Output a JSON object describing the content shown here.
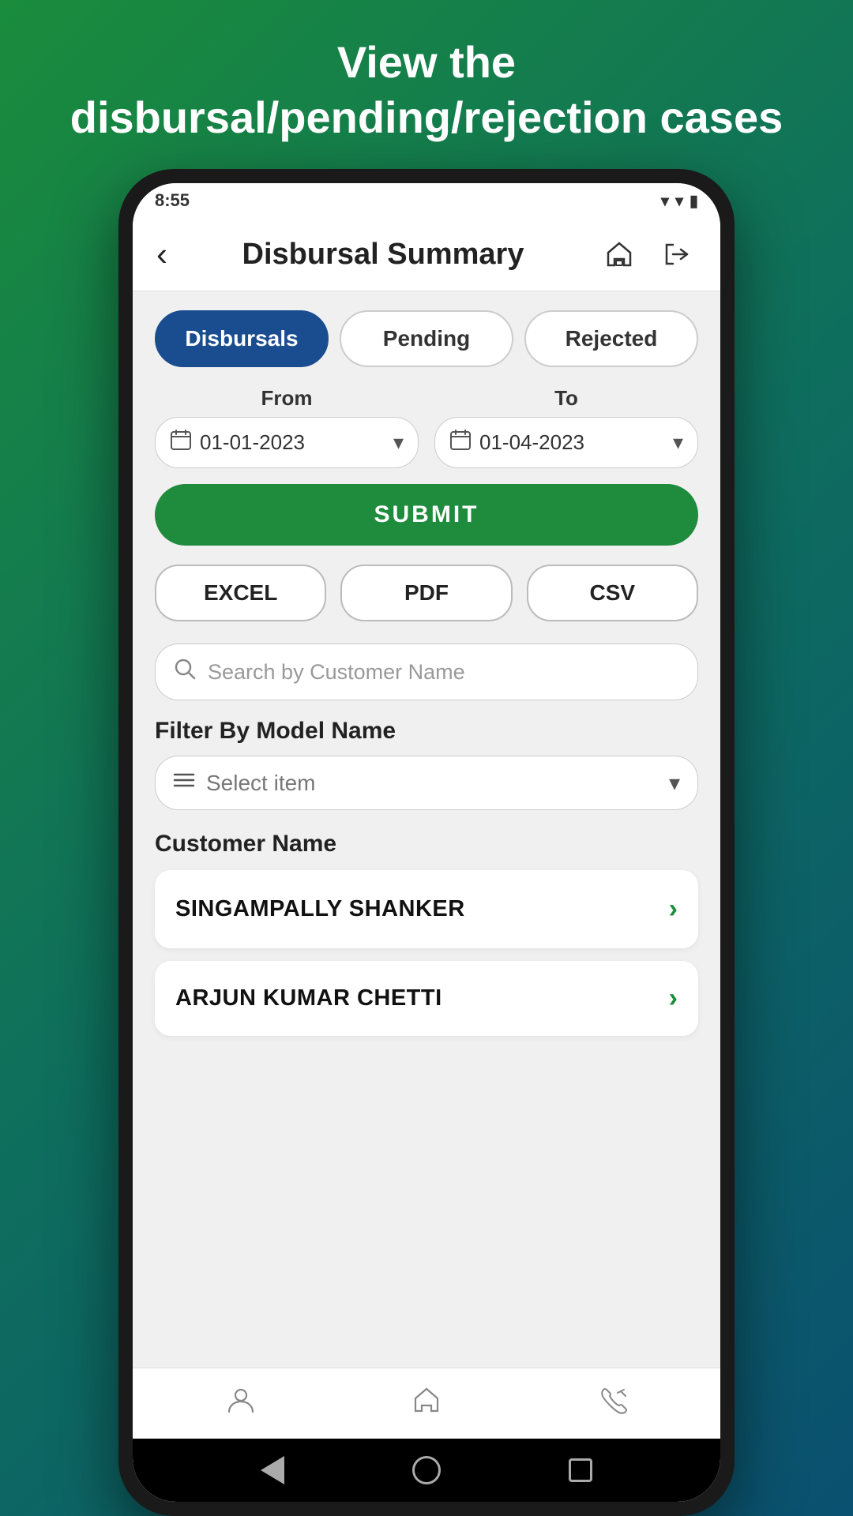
{
  "background": {
    "title_line1": "View the",
    "title_line2": "disbursal/pending/rejection cases"
  },
  "status_bar": {
    "time": "8:55",
    "icons": "▾ ▾ ▮"
  },
  "header": {
    "title": "Disbursal Summary",
    "back_label": "‹"
  },
  "tabs": [
    {
      "id": "disbursals",
      "label": "Disbursals",
      "active": true
    },
    {
      "id": "pending",
      "label": "Pending",
      "active": false
    },
    {
      "id": "rejected",
      "label": "Rejected",
      "active": false
    }
  ],
  "date_from": {
    "label": "From",
    "value": "01-01-2023"
  },
  "date_to": {
    "label": "To",
    "value": "01-04-2023"
  },
  "submit_button": "SUBMIT",
  "export_buttons": [
    {
      "id": "excel",
      "label": "EXCEL"
    },
    {
      "id": "pdf",
      "label": "PDF"
    },
    {
      "id": "csv",
      "label": "CSV"
    }
  ],
  "search": {
    "placeholder": "Search by Customer Name"
  },
  "filter": {
    "label": "Filter By Model Name",
    "placeholder": "Select item"
  },
  "customer_section": {
    "label": "Customer Name",
    "customers": [
      {
        "id": "1",
        "name": "SINGAMPALLY  SHANKER"
      },
      {
        "id": "2",
        "name": "ARJUN KUMAR CHETTI"
      }
    ]
  },
  "bottom_nav": [
    {
      "id": "profile",
      "icon": "👤"
    },
    {
      "id": "home",
      "icon": "🏠"
    },
    {
      "id": "phone",
      "icon": "📞"
    }
  ],
  "android_nav": {
    "back": "◀",
    "home": "●",
    "recent": "■"
  }
}
